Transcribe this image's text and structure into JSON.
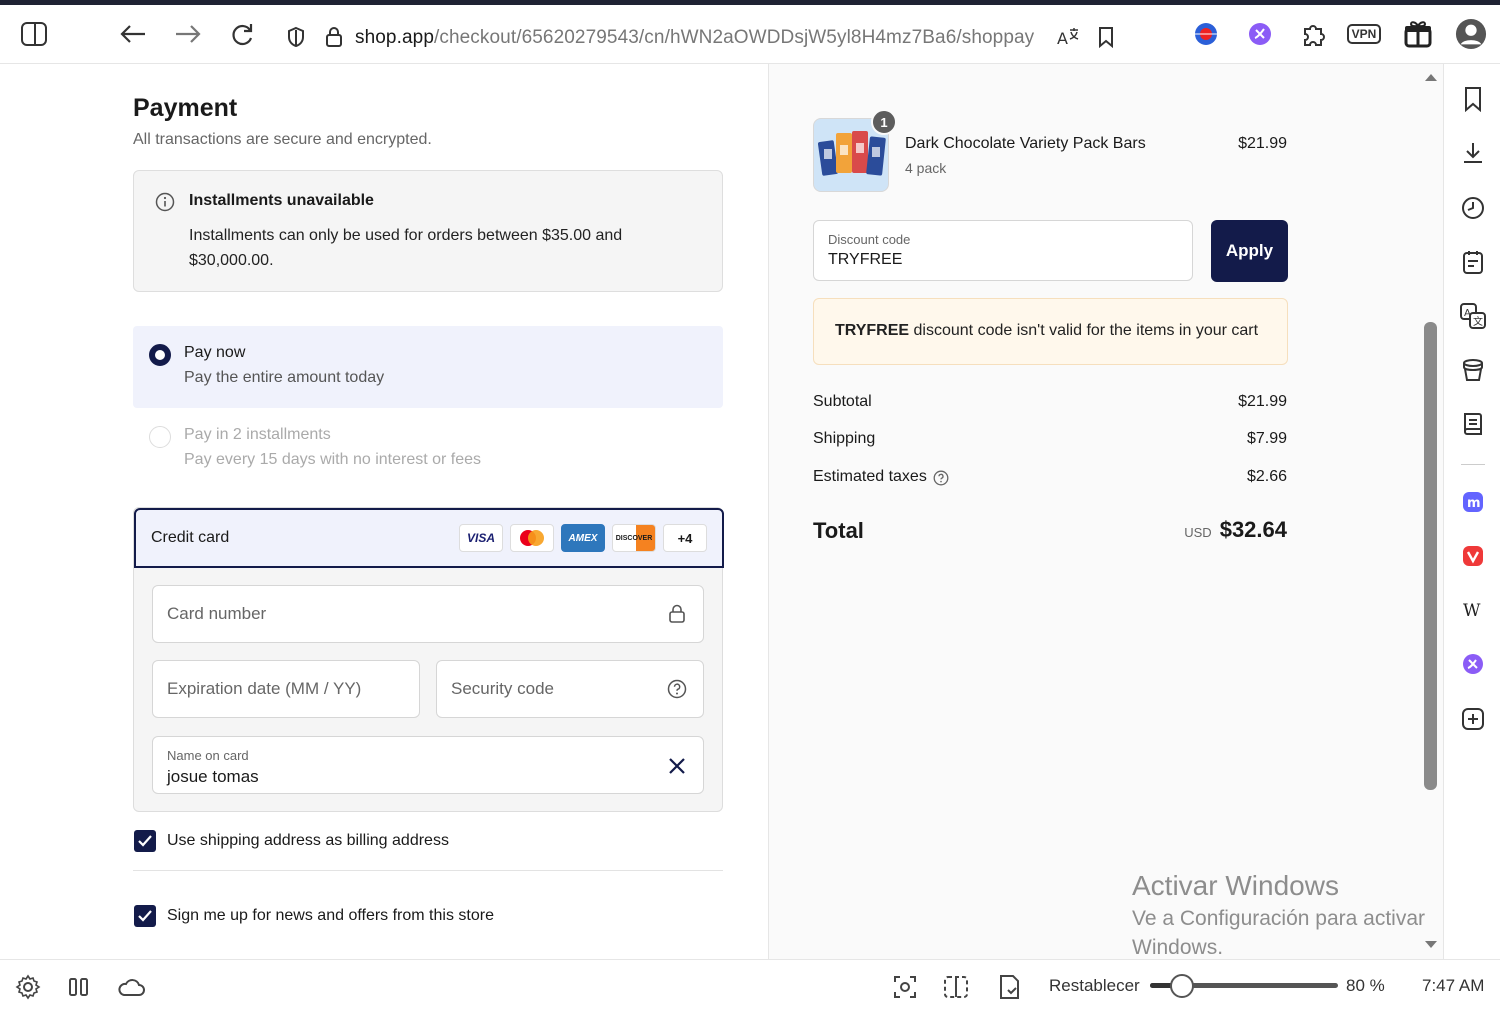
{
  "browser": {
    "url_domain": "shop.app",
    "url_path": "/checkout/65620279543/cn/hWN2aOWDDsjW5yl8H4mz7Ba6/shoppay",
    "vpn_label": "VPN"
  },
  "payment": {
    "title": "Payment",
    "subtitle": "All transactions are secure and encrypted.",
    "notice_title": "Installments unavailable",
    "notice_body": "Installments can only be used for orders between $35.00 and $30,000.00.",
    "options": [
      {
        "label": "Pay now",
        "description": "Pay the entire amount today",
        "selected": true
      },
      {
        "label": "Pay in 2 installments",
        "description": "Pay every 15 days with no interest or fees",
        "selected": false
      }
    ],
    "credit_card": {
      "title": "Credit card",
      "brands": [
        "VISA",
        "Mastercard",
        "AMEX",
        "DISCOVER"
      ],
      "more_brands": "+4",
      "card_number_placeholder": "Card number",
      "expiration_placeholder": "Expiration date (MM / YY)",
      "security_placeholder": "Security code",
      "name_label": "Name on card",
      "name_value": "josue tomas"
    },
    "checks": [
      {
        "label": "Use shipping address as billing address",
        "checked": true
      },
      {
        "label": "Sign me up for news and offers from this store",
        "checked": true
      }
    ]
  },
  "summary": {
    "product": {
      "name": "Dark Chocolate Variety Pack Bars",
      "variant": "4 pack",
      "price": "$21.99",
      "quantity": "1"
    },
    "discount_label": "Discount code",
    "discount_value": "TRYFREE",
    "apply_label": "Apply",
    "warning_code": "TRYFREE",
    "warning_text": " discount code isn't valid for the items in your cart",
    "rows": [
      {
        "label": "Subtotal",
        "value": "$21.99"
      },
      {
        "label": "Shipping",
        "value": "$7.99"
      },
      {
        "label": "Estimated taxes",
        "value": "$2.66"
      }
    ],
    "total_label": "Total",
    "total_currency": "USD",
    "total_value": "$32.64"
  },
  "watermark": {
    "line1": "Activar Windows",
    "line2": "Ve a Configuración para activar",
    "line3": "Windows."
  },
  "statusbar": {
    "reset_label": "Restablecer",
    "zoom": "80 %",
    "zoom_level": 0.8,
    "time": "7:47 AM"
  },
  "colors": {
    "accent": "#131b4a",
    "warning_bg": "#fff8ec",
    "selected_bg": "#f0f2fc"
  }
}
